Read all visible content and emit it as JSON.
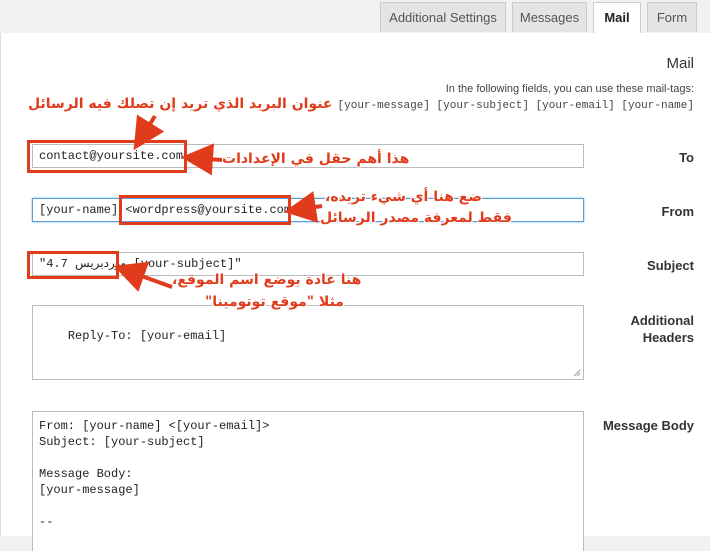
{
  "tabs": [
    {
      "label": "Additional Settings"
    },
    {
      "label": "Messages"
    },
    {
      "label": "Mail"
    },
    {
      "label": "Form"
    }
  ],
  "active_tab": "Mail",
  "section": {
    "title": "Mail",
    "hint": "In the following fields, you can use these mail-tags:",
    "tags": "[your-message] [your-subject] [your-email] [your-name]"
  },
  "fields": {
    "to": {
      "label": "To",
      "value": "contact@yoursite.com"
    },
    "from": {
      "label": "From",
      "value": "[your-name] <wordpress@yoursite.com>"
    },
    "subject": {
      "label": "Subject",
      "value": "\"ووردبريس 4.7 [your-subject]\""
    },
    "additional_headers": {
      "label": "Additional Headers",
      "value": "Reply-To: [your-email]"
    },
    "message_body": {
      "label": "Message Body",
      "value": "From: [your-name] <[your-email]>\nSubject: [your-subject]\n\nMessage Body:\n[your-message]\n\n--"
    }
  },
  "annotations": {
    "to_address": "عنوان البريد الذي تريد إن تصلك فيه الرسائل",
    "to_important": "هذا أهم حقل في الإعدادات",
    "from_line1": "ضع هنا أي شيء تريده،",
    "from_line2": "فقط لمعرفة مصدر الرسائل",
    "subject_line1": "هنا عادة يوضع اسم الموقع،",
    "subject_line2": "مثلا \"موقع توتومينا\"",
    "color": "#e03c1c"
  }
}
